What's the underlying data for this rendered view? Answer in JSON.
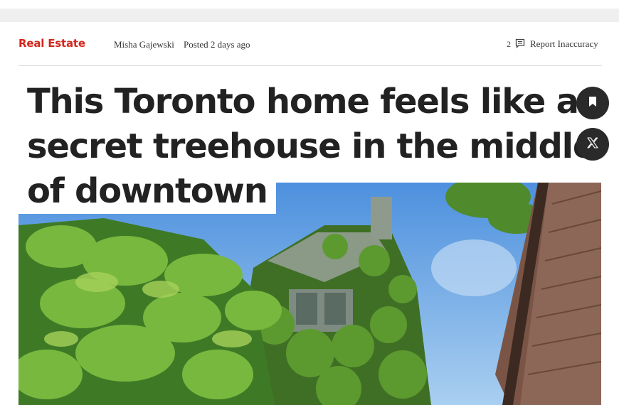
{
  "article": {
    "category": "Real Estate",
    "author": "Misha Gajewski",
    "posted": "Posted 2 days ago",
    "comment_count": "2",
    "report_label": "Report Inaccuracy",
    "title_lines": [
      "This Toronto home feels like a",
      "secret treehouse in the middle",
      "of downtown"
    ]
  },
  "icons": {
    "comment": "comment-icon",
    "bookmark": "bookmark-icon",
    "share": "x-logo-icon"
  },
  "colors": {
    "category": "#d3261c",
    "button_bg": "#2a2a2a",
    "sky": "#6aa8e0",
    "foliage": "#4f8a2c"
  }
}
